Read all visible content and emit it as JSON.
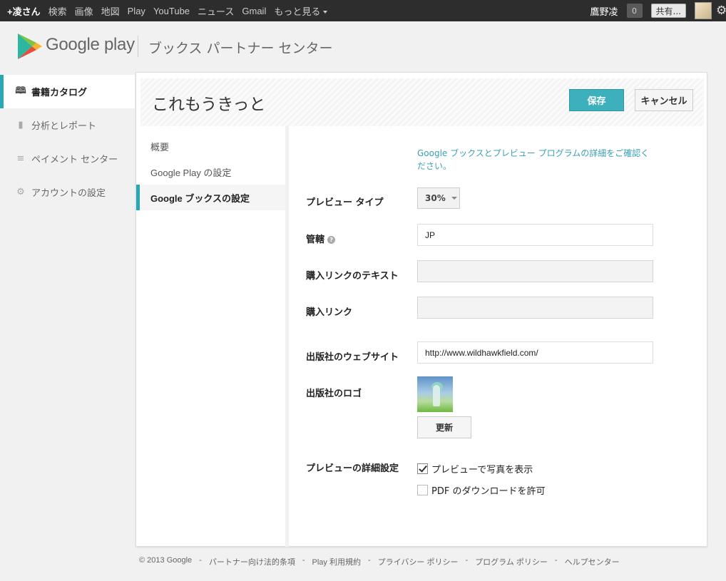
{
  "topbar": {
    "nav": [
      "+凌さん",
      "検索",
      "画像",
      "地図",
      "Play",
      "YouTube",
      "ニュース",
      "Gmail",
      "もっと見る"
    ],
    "username": "鷹野凌",
    "notifications": "0",
    "share": "共有..."
  },
  "header": {
    "logo_text": "Google play",
    "subtitle": "ブックス パートナー センター"
  },
  "leftnav": [
    {
      "label": "書籍カタログ",
      "icon": "book-icon",
      "active": true
    },
    {
      "label": "分析とレポート",
      "icon": "bar-chart-icon",
      "active": false
    },
    {
      "label": "ペイメント センター",
      "icon": "coins-icon",
      "active": false
    },
    {
      "label": "アカウントの設定",
      "icon": "gear-icon",
      "active": false
    }
  ],
  "panel": {
    "title": "これもうきっと",
    "save_label": "保存",
    "cancel_label": "キャンセル"
  },
  "subnav": [
    "概要",
    "Google Play の設定",
    "Google ブックスの設定"
  ],
  "form": {
    "info_link": "Google ブックスとプレビュー プログラムの詳細をご確認ください。",
    "preview_type_label": "プレビュー タイプ",
    "preview_type_value": "30%",
    "jurisdiction_label": "管轄",
    "jurisdiction_value": "JP",
    "buy_link_text_label": "購入リンクのテキスト",
    "buy_link_text_value": "",
    "buy_link_label": "購入リンク",
    "buy_link_value": "",
    "publisher_site_label": "出版社のウェブサイト",
    "publisher_site_value": "http://www.wildhawkfield.com/",
    "publisher_logo_label": "出版社のロゴ",
    "update_label": "更新",
    "preview_detail_label": "プレビューの詳細設定",
    "option_show_photos": "プレビューで写真を表示",
    "option_show_photos_checked": true,
    "option_pdf_download": "PDF のダウンロードを許可",
    "option_pdf_download_checked": false
  },
  "footer": [
    "© 2013 Google",
    "パートナー向け法的条項",
    "Play 利用規約",
    "プライバシー ポリシー",
    "プログラム ポリシー",
    "ヘルプセンター"
  ],
  "colors": {
    "accent": "#3eb0bd",
    "link": "#3aa0b5"
  }
}
